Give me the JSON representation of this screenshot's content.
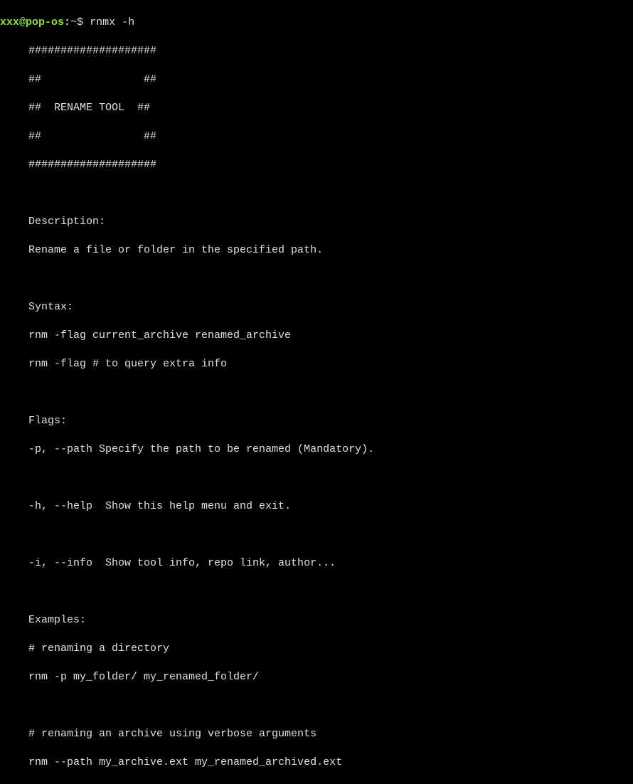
{
  "prompt": {
    "user": "xxx@pop-os",
    "colon": ":",
    "tilde": "~",
    "dollar": "$ "
  },
  "command": "rnmx -h",
  "output": {
    "banner1": "####################",
    "banner2": "##                ##",
    "banner3": "##  RENAME TOOL  ##",
    "banner4": "##                ##",
    "banner5": "####################",
    "blank1": "",
    "desc_head": "Description:",
    "desc_body": "Rename a file or folder in the specified path.",
    "blank2": "",
    "syntax_head": "Syntax:",
    "syntax1": "rnm -flag current_archive renamed_archive",
    "syntax2": "rnm -flag # to query extra info",
    "blank3": "",
    "flags_head": "Flags:",
    "flag_p": "-p, --path Specify the path to be renamed (Mandatory).",
    "blank4": "",
    "flag_h": "-h, --help  Show this help menu and exit.",
    "blank5": "",
    "flag_i": "-i, --info  Show tool info, repo link, author...",
    "blank6": "",
    "ex_head": "Examples:",
    "ex1_comment": "# renaming a directory",
    "ex1_cmd": "rnm -p my_folder/ my_renamed_folder/",
    "blank7": "",
    "ex2_comment": "# renaming an archive using verbose arguments",
    "ex2_cmd": "rnm --path my_archive.ext my_renamed_archived.ext"
  }
}
